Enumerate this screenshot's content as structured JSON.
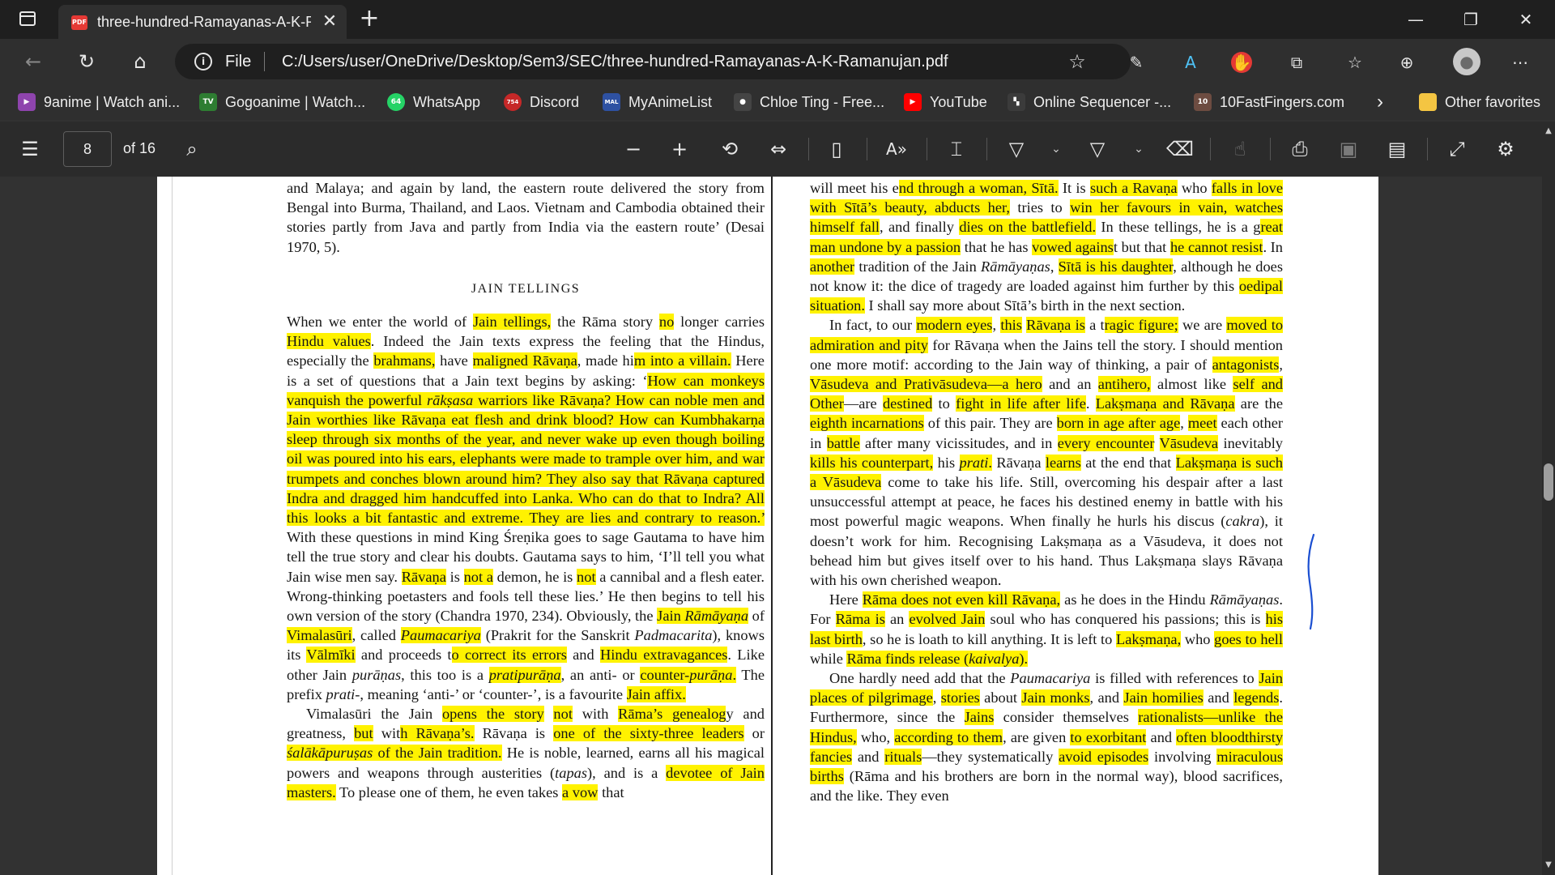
{
  "tab": {
    "title": "three-hundred-Ramayanas-A-K-Ramanujan.pdf",
    "pdf_badge": "PDF"
  },
  "window": {
    "minimize": "—",
    "restore": "❐",
    "close": "✕"
  },
  "address": {
    "scheme_label": "File",
    "url": "C:/Users/user/OneDrive/Desktop/Sem3/SEC/three-hundred-Ramayanas-A-K-Ramanujan.pdf"
  },
  "favorites": [
    {
      "label": "9anime | Watch ani...",
      "icon": "9anime-icon",
      "color": "#8e44ad",
      "glyph": "▶"
    },
    {
      "label": "Gogoanime | Watch...",
      "icon": "gogoanime-icon",
      "color": "#2e7d32",
      "glyph": "TV"
    },
    {
      "label": "WhatsApp",
      "icon": "whatsapp-icon",
      "color": "#25d366",
      "glyph": "64"
    },
    {
      "label": "Discord",
      "icon": "discord-icon",
      "color": "#c62828",
      "glyph": "754"
    },
    {
      "label": "MyAnimeList",
      "icon": "myanimelist-icon",
      "color": "#2e51a2",
      "glyph": "MAL"
    },
    {
      "label": "Chloe Ting - Free...",
      "icon": "chloe-ting-icon",
      "color": "#444444",
      "glyph": "●"
    },
    {
      "label": "YouTube",
      "icon": "youtube-icon",
      "color": "#ff0000",
      "glyph": "▶"
    },
    {
      "label": "Online Sequencer -...",
      "icon": "online-sequencer-icon",
      "color": "#3b3b3b",
      "glyph": "▚"
    },
    {
      "label": "10FastFingers.com",
      "icon": "10fastfingers-icon",
      "color": "#6d4c41",
      "glyph": "10"
    }
  ],
  "favorites_overflow": "›",
  "other_favorites": "Other favorites",
  "pdf_toolbar": {
    "page_current": "8",
    "page_total": "of 16"
  },
  "doc": {
    "left_heading": "JAIN TELLINGS",
    "margin_mark": "❙"
  },
  "colors": {
    "highlight": "#fff200",
    "accent": "#2b2b2b",
    "pen": "#1b4fd1"
  }
}
